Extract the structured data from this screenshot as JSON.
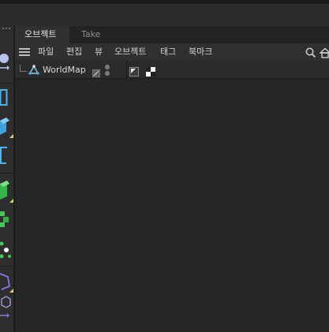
{
  "tabs": [
    {
      "label": "오브젝트",
      "active": true
    },
    {
      "label": "Take",
      "active": false
    }
  ],
  "menu": {
    "items": [
      "파일",
      "편집",
      "뷰",
      "오브젝트",
      "태그",
      "북마크"
    ]
  },
  "object_tree": {
    "items": [
      {
        "label": "WorldMap",
        "icon": "null-object-icon"
      }
    ]
  },
  "icons": {
    "menu": "hamburger-menu-icon",
    "search": "search-icon",
    "home": "home-icon"
  },
  "colors": {
    "accent_tool": "#9ad0f5",
    "green_tool": "#48c45a",
    "purple_tool": "#8a78e6",
    "corner_marker": "#d7d36b"
  }
}
